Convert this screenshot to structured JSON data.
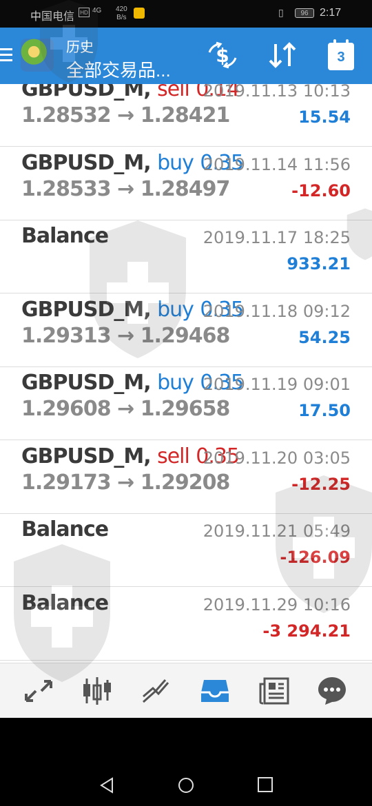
{
  "status_bar": {
    "carrier": "中国电信",
    "hd": "HD",
    "signal": "4G",
    "speed_value": "420",
    "speed_unit": "B/s",
    "battery": "96",
    "time": "2:17"
  },
  "app_bar": {
    "title": "历史",
    "subtitle": "全部交易品...",
    "calendar_number": "3"
  },
  "colors": {
    "app_bar": "#2b87d8",
    "sell": "#d32626",
    "buy": "#1f7fd6",
    "profit_positive": "#1f7fd6",
    "profit_negative": "#d32626"
  },
  "history": [
    {
      "symbol": "GBPUSD_M,",
      "side": "sell",
      "volume": "0.14",
      "date": "2019.11.13 10:13",
      "open": "1.28532",
      "arrow": "→",
      "close": "1.28421",
      "profit": "15.54",
      "profit_sign": "pos"
    },
    {
      "symbol": "GBPUSD_M,",
      "side": "buy",
      "volume": "0.35",
      "date": "2019.11.14 11:56",
      "open": "1.28533",
      "arrow": "→",
      "close": "1.28497",
      "profit": "-12.60",
      "profit_sign": "neg"
    },
    {
      "symbol": "Balance",
      "side": "",
      "volume": "",
      "date": "2019.11.17 18:25",
      "open": "",
      "arrow": "",
      "close": "",
      "profit": "933.21",
      "profit_sign": "pos"
    },
    {
      "symbol": "GBPUSD_M,",
      "side": "buy",
      "volume": "0.35",
      "date": "2019.11.18 09:12",
      "open": "1.29313",
      "arrow": "→",
      "close": "1.29468",
      "profit": "54.25",
      "profit_sign": "pos"
    },
    {
      "symbol": "GBPUSD_M,",
      "side": "buy",
      "volume": "0.35",
      "date": "2019.11.19 09:01",
      "open": "1.29608",
      "arrow": "→",
      "close": "1.29658",
      "profit": "17.50",
      "profit_sign": "pos"
    },
    {
      "symbol": "GBPUSD_M,",
      "side": "sell",
      "volume": "0.35",
      "date": "2019.11.20 03:05",
      "open": "1.29173",
      "arrow": "→",
      "close": "1.29208",
      "profit": "-12.25",
      "profit_sign": "neg"
    },
    {
      "symbol": "Balance",
      "side": "",
      "volume": "",
      "date": "2019.11.21 05:49",
      "open": "",
      "arrow": "",
      "close": "",
      "profit": "-126.09",
      "profit_sign": "neg"
    },
    {
      "symbol": "Balance",
      "side": "",
      "volume": "",
      "date": "2019.11.29 10:16",
      "open": "",
      "arrow": "",
      "close": "",
      "profit": "-3 294.21",
      "profit_sign": "neg"
    }
  ],
  "bottom_nav": [
    {
      "name": "quotes-icon"
    },
    {
      "name": "chart-candles-icon"
    },
    {
      "name": "trade-icon"
    },
    {
      "name": "history-inbox-icon",
      "active": true
    },
    {
      "name": "news-icon"
    },
    {
      "name": "chat-icon"
    }
  ]
}
